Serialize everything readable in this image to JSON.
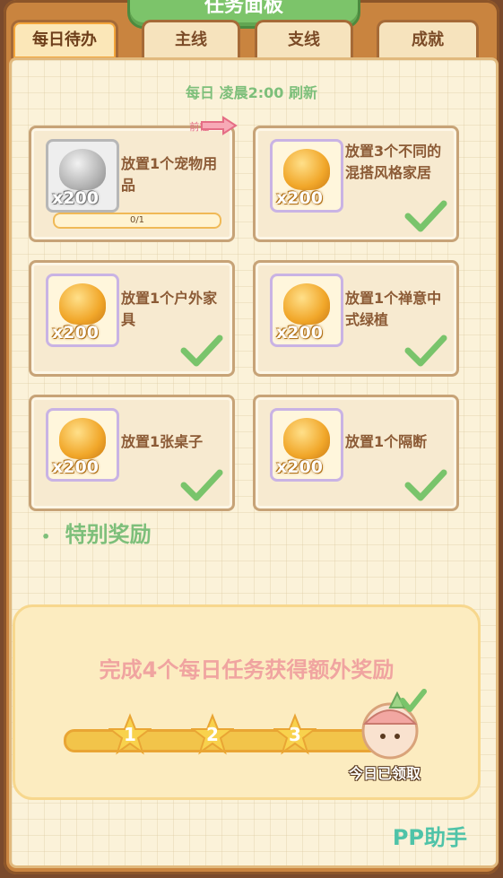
{
  "header": {
    "title": "任务面板"
  },
  "tabs": [
    {
      "label": "每日待办",
      "active": true
    },
    {
      "label": "主线",
      "active": false
    },
    {
      "label": "支线",
      "active": false
    },
    {
      "label": "成就",
      "active": false
    }
  ],
  "daily": {
    "refresh_text": "每日 凌晨2:00 刷新",
    "goto_label": "前往:",
    "tasks": [
      {
        "text": "放置1个宠物用品",
        "reward": "x200",
        "reward_style": "silver",
        "progress": "0/1",
        "completed": false
      },
      {
        "text": "放置3个不同的混搭风格家居",
        "reward": "x200",
        "reward_style": "gold",
        "completed": true
      },
      {
        "text": "放置1个户外家具",
        "reward": "x200",
        "reward_style": "gold",
        "completed": true
      },
      {
        "text": "放置1个禅意中式绿植",
        "reward": "x200",
        "reward_style": "gold",
        "completed": true
      },
      {
        "text": "放置1张桌子",
        "reward": "x200",
        "reward_style": "gold",
        "completed": true
      },
      {
        "text": "放置1个隔断",
        "reward": "x200",
        "reward_style": "gold",
        "completed": true
      }
    ]
  },
  "special": {
    "title": "特别奖励",
    "description": "完成4个每日任务获得额外奖励",
    "milestones": [
      "1",
      "2",
      "3"
    ],
    "claimed_text": "今日已领取"
  },
  "brand": "PP助手",
  "colors": {
    "accent_green": "#7dbf7a",
    "frame_brown": "#c9843f",
    "coin_gold": "#f1a72a"
  }
}
